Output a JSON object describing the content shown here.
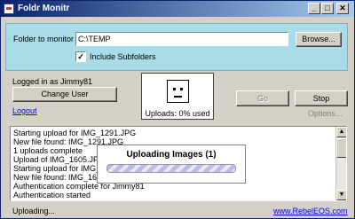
{
  "window": {
    "title": "Foldr Monitr"
  },
  "titlebar": {
    "minimize": "_",
    "maximize": "□",
    "close": "✕"
  },
  "folder": {
    "label": "Folder to monitor",
    "value": "C:\\TEMP",
    "browse": "Browse...",
    "include_subfolders": "Include Subfolders",
    "include_checked": "✓"
  },
  "user": {
    "logged_in": "Logged in as Jimmy81",
    "change_user": "Change User",
    "logout": "Logout"
  },
  "status_panel": {
    "uploads": "Uploads: 0% used"
  },
  "controls": {
    "go": "Go",
    "stop": "Stop",
    "options": "Options..."
  },
  "log": [
    "Starting upload for IMG_1291.JPG",
    "New file found: IMG_1291.JPG",
    "1 uploads complete",
    "Upload of IMG_1605.JPG",
    "Starting upload for IMG_1605.JPG",
    "New file found: IMG_1605.JPG",
    "Authentication complete for Jimmy81",
    "Authentication started"
  ],
  "dialog": {
    "title": "Uploading Images (1)"
  },
  "statusbar": {
    "status": "Uploading...",
    "link": "www.RebelEOS.com"
  }
}
